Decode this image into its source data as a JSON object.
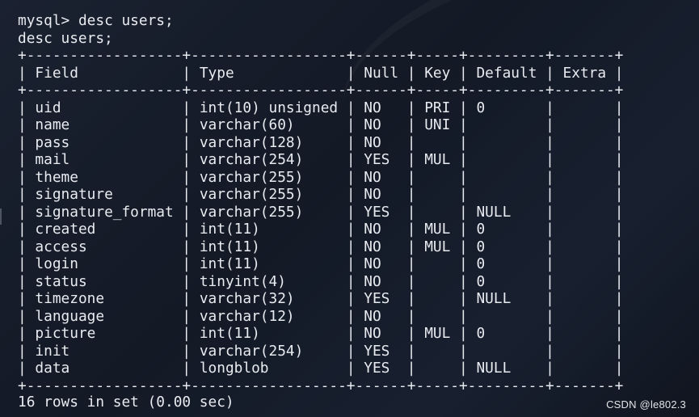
{
  "terminal": {
    "prompt": "mysql>",
    "command": "desc users;",
    "echo": "desc users;",
    "summary": "16 rows in set (0.00 sec)"
  },
  "table": {
    "columns": [
      "Field",
      "Type",
      "Null",
      "Key",
      "Default",
      "Extra"
    ],
    "rows": [
      [
        "uid",
        "int(10) unsigned",
        "NO",
        "PRI",
        "0",
        ""
      ],
      [
        "name",
        "varchar(60)",
        "NO",
        "UNI",
        "",
        ""
      ],
      [
        "pass",
        "varchar(128)",
        "NO",
        "",
        "",
        ""
      ],
      [
        "mail",
        "varchar(254)",
        "YES",
        "MUL",
        "",
        ""
      ],
      [
        "theme",
        "varchar(255)",
        "NO",
        "",
        "",
        ""
      ],
      [
        "signature",
        "varchar(255)",
        "NO",
        "",
        "",
        ""
      ],
      [
        "signature_format",
        "varchar(255)",
        "YES",
        "",
        "NULL",
        ""
      ],
      [
        "created",
        "int(11)",
        "NO",
        "MUL",
        "0",
        ""
      ],
      [
        "access",
        "int(11)",
        "NO",
        "MUL",
        "0",
        ""
      ],
      [
        "login",
        "int(11)",
        "NO",
        "",
        "0",
        ""
      ],
      [
        "status",
        "tinyint(4)",
        "NO",
        "",
        "0",
        ""
      ],
      [
        "timezone",
        "varchar(32)",
        "YES",
        "",
        "NULL",
        ""
      ],
      [
        "language",
        "varchar(12)",
        "NO",
        "",
        "",
        ""
      ],
      [
        "picture",
        "int(11)",
        "NO",
        "MUL",
        "0",
        ""
      ],
      [
        "init",
        "varchar(254)",
        "YES",
        "",
        "",
        ""
      ],
      [
        "data",
        "longblob",
        "YES",
        "",
        "NULL",
        ""
      ]
    ]
  },
  "watermark": "CSDN @le802.3"
}
